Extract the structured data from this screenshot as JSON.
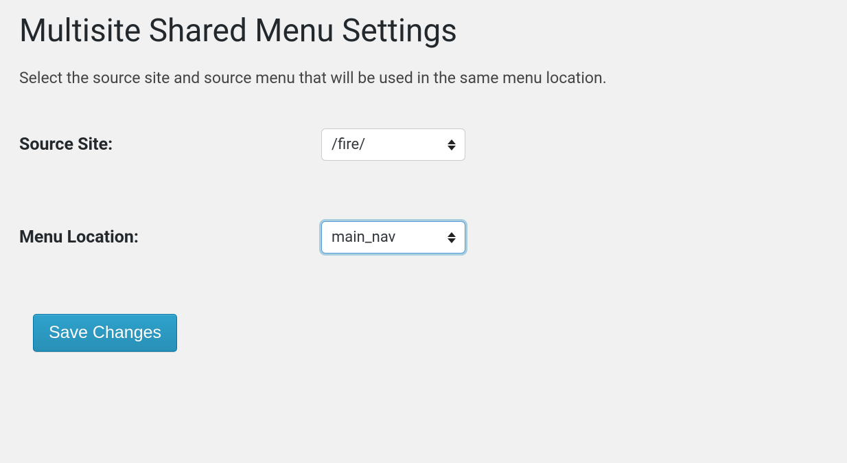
{
  "header": {
    "title": "Multisite Shared Menu Settings",
    "description": "Select the source site and source menu that will be used in the same menu location."
  },
  "form": {
    "source_site": {
      "label": "Source Site:",
      "value": "/fire/"
    },
    "menu_location": {
      "label": "Menu Location:",
      "value": "main_nav"
    },
    "save_label": "Save Changes"
  }
}
